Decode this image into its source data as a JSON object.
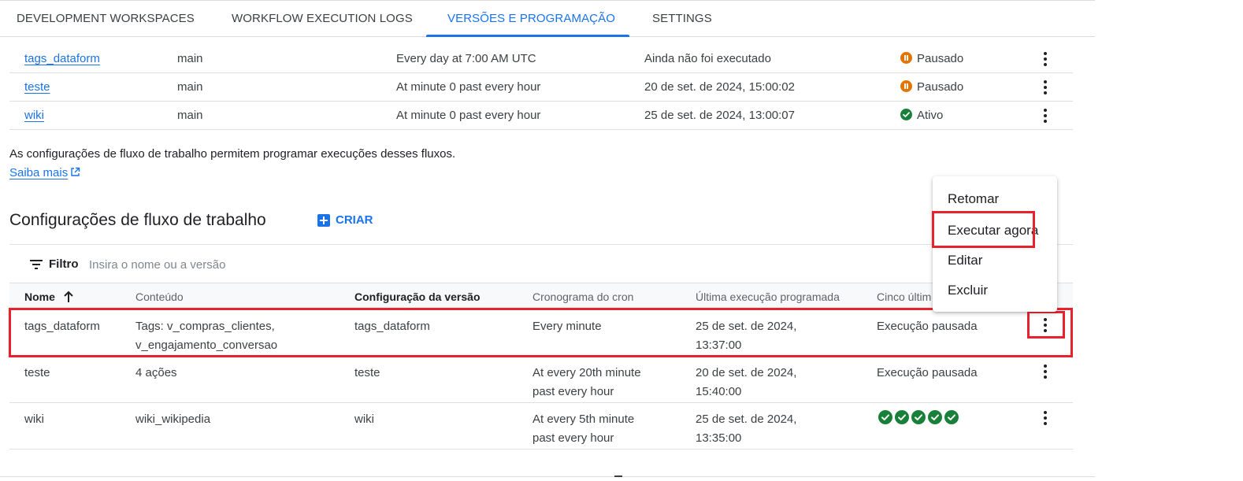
{
  "tabs": [
    {
      "label": "DEVELOPMENT WORKSPACES"
    },
    {
      "label": "WORKFLOW EXECUTION LOGS"
    },
    {
      "label": "VERSÕES E PROGRAMAÇÃO"
    },
    {
      "label": "SETTINGS"
    }
  ],
  "release_rows": [
    {
      "name": "tags_dataform",
      "branch": "main",
      "schedule": "Every day at 7:00 AM UTC",
      "last_run": "Ainda não foi executado",
      "status": "Pausado"
    },
    {
      "name": "teste",
      "branch": "main",
      "schedule": "At minute 0 past every hour",
      "last_run": "20 de set. de 2024, 15:00:02",
      "status": "Pausado"
    },
    {
      "name": "wiki",
      "branch": "main",
      "schedule": "At minute 0 past every hour",
      "last_run": "25 de set. de 2024, 13:00:07",
      "status": "Ativo"
    }
  ],
  "info": {
    "text": "As configurações de fluxo de trabalho permitem programar execuções desses fluxos.",
    "link": "Saiba mais"
  },
  "workflow_section": {
    "title": "Configurações de fluxo de trabalho",
    "create_label": "CRIAR"
  },
  "filter": {
    "label": "Filtro",
    "placeholder": "Insira o nome ou a versão"
  },
  "columns": [
    "Nome",
    "Conteúdo",
    "Configuração da versão",
    "Cronograma do cron",
    "Última execução programada",
    "Cinco últim"
  ],
  "workflow_rows": [
    {
      "name": "tags_dataform",
      "content_1": "Tags: v_compras_clientes,",
      "content_2": "v_engajamento_conversao",
      "release": "tags_dataform",
      "cron_1": "Every minute",
      "cron_2": "",
      "last_1": "25 de set. de 2024,",
      "last_2": "13:37:00",
      "recent": "Execução pausada"
    },
    {
      "name": "teste",
      "content_1": "4 ações",
      "content_2": "",
      "release": "teste",
      "cron_1": "At every 20th minute",
      "cron_2": "past every hour",
      "last_1": "20 de set. de 2024,",
      "last_2": "15:40:00",
      "recent": "Execução pausada"
    },
    {
      "name": "wiki",
      "content_1": "wiki_wikipedia",
      "content_2": "",
      "release": "wiki",
      "cron_1": "At every 5th minute",
      "cron_2": "past every hour",
      "last_1": "25 de set. de 2024,",
      "last_2": "13:35:00",
      "recent": ""
    }
  ],
  "menu": {
    "items": [
      "Retomar",
      "Executar agora",
      "Editar",
      "Excluir"
    ]
  },
  "colors": {
    "accent": "#1a73e8",
    "paused": "#e37400",
    "success": "#188038",
    "highlight": "#e8212d"
  }
}
